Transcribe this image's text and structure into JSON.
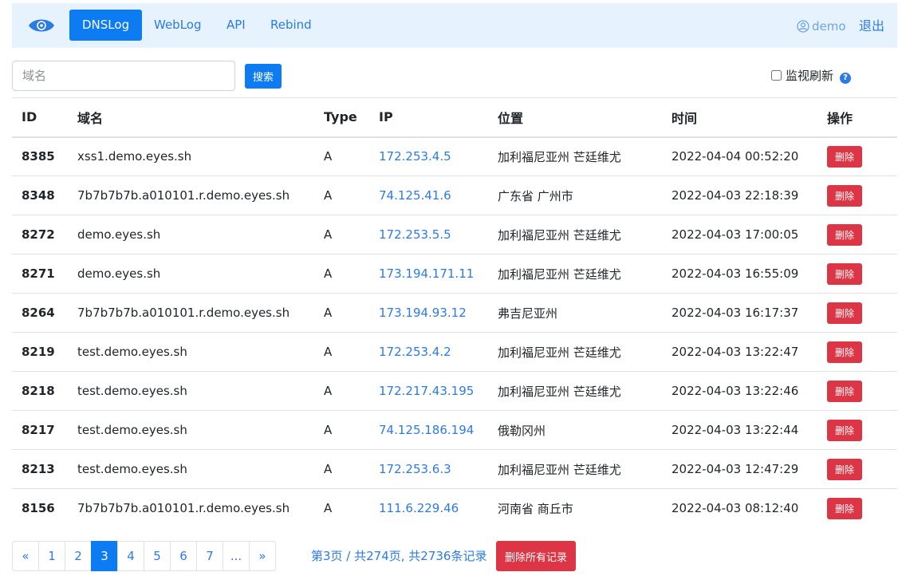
{
  "nav": {
    "logo_icon": "eye-icon",
    "items": [
      {
        "label": "DNSLog",
        "active": true
      },
      {
        "label": "WebLog",
        "active": false
      },
      {
        "label": "API",
        "active": false
      },
      {
        "label": "Rebind",
        "active": false
      }
    ],
    "user": "demo",
    "user_icon": "user-circle-icon",
    "logout": "退出"
  },
  "search": {
    "placeholder": "域名",
    "value": "",
    "button": "搜索",
    "monitor_label": "监视刷新",
    "monitor_checked": false,
    "help_icon": "question-circle-icon",
    "help_glyph": "?"
  },
  "table": {
    "headers": [
      "ID",
      "域名",
      "Type",
      "IP",
      "位置",
      "时间",
      "操作"
    ],
    "delete_label": "删除",
    "rows": [
      {
        "id": "8385",
        "domain": "xss1.demo.eyes.sh",
        "type": "A",
        "ip": "172.253.4.5",
        "location": "加利福尼亚州 芒廷维尤",
        "time": "2022-04-04 00:52:20"
      },
      {
        "id": "8348",
        "domain": "7b7b7b7b.a010101.r.demo.eyes.sh",
        "type": "A",
        "ip": "74.125.41.6",
        "location": "广东省 广州市",
        "time": "2022-04-03 22:18:39"
      },
      {
        "id": "8272",
        "domain": "demo.eyes.sh",
        "type": "A",
        "ip": "172.253.5.5",
        "location": "加利福尼亚州 芒廷维尤",
        "time": "2022-04-03 17:00:05"
      },
      {
        "id": "8271",
        "domain": "demo.eyes.sh",
        "type": "A",
        "ip": "173.194.171.11",
        "location": "加利福尼亚州 芒廷维尤",
        "time": "2022-04-03 16:55:09"
      },
      {
        "id": "8264",
        "domain": "7b7b7b7b.a010101.r.demo.eyes.sh",
        "type": "A",
        "ip": "173.194.93.12",
        "location": "弗吉尼亚州",
        "time": "2022-04-03 16:17:37"
      },
      {
        "id": "8219",
        "domain": "test.demo.eyes.sh",
        "type": "A",
        "ip": "172.253.4.2",
        "location": "加利福尼亚州 芒廷维尤",
        "time": "2022-04-03 13:22:47"
      },
      {
        "id": "8218",
        "domain": "test.demo.eyes.sh",
        "type": "A",
        "ip": "172.217.43.195",
        "location": "加利福尼亚州 芒廷维尤",
        "time": "2022-04-03 13:22:46"
      },
      {
        "id": "8217",
        "domain": "test.demo.eyes.sh",
        "type": "A",
        "ip": "74.125.186.194",
        "location": "俄勒冈州",
        "time": "2022-04-03 13:22:44"
      },
      {
        "id": "8213",
        "domain": "test.demo.eyes.sh",
        "type": "A",
        "ip": "172.253.6.3",
        "location": "加利福尼亚州 芒廷维尤",
        "time": "2022-04-03 12:47:29"
      },
      {
        "id": "8156",
        "domain": "7b7b7b7b.a010101.r.demo.eyes.sh",
        "type": "A",
        "ip": "111.6.229.46",
        "location": "河南省 商丘市",
        "time": "2022-04-03 08:12:40"
      }
    ]
  },
  "pagination": {
    "items": [
      "«",
      "1",
      "2",
      "3",
      "4",
      "5",
      "6",
      "7",
      "...",
      "»"
    ],
    "active": "3",
    "info": "第3页 / 共274页, 共2736条记录",
    "delete_all": "删除所有记录"
  },
  "colors": {
    "primary": "#0d7bf2",
    "link": "#2c7be5",
    "danger": "#dc3545",
    "navbar_bg": "#e6f2fd"
  }
}
